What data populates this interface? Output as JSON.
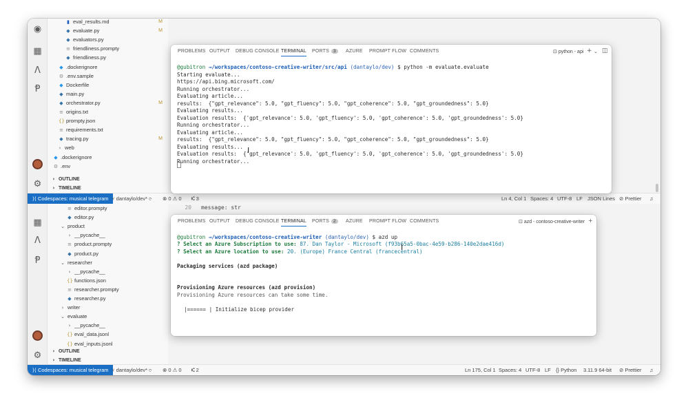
{
  "top_window": {
    "explorer_items": [
      {
        "name": "eval_results.md",
        "icon": "markdown-icon",
        "badge": "M"
      },
      {
        "name": "evaluate.py",
        "icon": "python-icon",
        "badge": "M"
      },
      {
        "name": "evaluators.py",
        "icon": "python-icon",
        "badge": ""
      },
      {
        "name": "friendliness.prompty",
        "icon": "file-icon",
        "badge": ""
      },
      {
        "name": "friendliness.py",
        "icon": "python-icon",
        "badge": ""
      },
      {
        "name": ".dockerignore",
        "icon": "docker-icon",
        "badge": ""
      },
      {
        "name": ".env.sample",
        "icon": "gear-icon",
        "badge": ""
      },
      {
        "name": "Dockerfile",
        "icon": "docker-icon",
        "badge": ""
      },
      {
        "name": "main.py",
        "icon": "python-icon",
        "badge": ""
      },
      {
        "name": "orchestrator.py",
        "icon": "python-icon",
        "badge": "M"
      },
      {
        "name": "origins.txt",
        "icon": "text-icon",
        "badge": ""
      },
      {
        "name": "prompty.json",
        "icon": "json-icon",
        "badge": ""
      },
      {
        "name": "requirements.txt",
        "icon": "text-icon",
        "badge": ""
      },
      {
        "name": "tracing.py",
        "icon": "python-icon",
        "badge": "M"
      },
      {
        "name": "web",
        "icon": "chevron-right-icon",
        "badge": ""
      },
      {
        "name": ".dockerignore",
        "icon": "docker-icon",
        "badge": ""
      },
      {
        "name": ".env",
        "icon": "gear-icon",
        "badge": ""
      }
    ],
    "sections": [
      "OUTLINE",
      "TIMELINE"
    ],
    "status": {
      "remote": "Codespaces: musical telegram",
      "branch": "dantaylo/dev*",
      "problems": "0 ⚠ 0",
      "ports": "3",
      "ln_col": "Ln 4, Col 1",
      "spaces": "Spaces: 4",
      "encoding": "UTF-8",
      "eol": "LF",
      "language": "JSON Lines",
      "formatter": "Prettier"
    },
    "panel": {
      "tabs": [
        "PROBLEMS",
        "OUTPUT",
        "DEBUG CONSOLE",
        "TERMINAL",
        "PORTS",
        "AZURE",
        "PROMPT FLOW",
        "COMMENTS"
      ],
      "ports_count": "3",
      "terminal_name": "python - api",
      "prompt_user": "@gubitron",
      "prompt_arrow": "→",
      "prompt_path": "/workspaces/contoso-creative-writer/src/api",
      "prompt_branch": "(dantaylo/dev)",
      "prompt_cmd": "$ python -m evaluate.evaluate",
      "lines": [
        "Starting evaluate...",
        "https://api.bing.microsoft.com/",
        "Running orchestrator...",
        "Evaluating article...",
        "results:  {\"gpt_relevance\": 5.0, \"gpt_fluency\": 5.0, \"gpt_coherence\": 5.0, \"gpt_groundedness\": 5.0}",
        "Evaluating results...",
        "Evaluation results:  {'gpt_relevance': 5.0, 'gpt_fluency': 5.0, 'gpt_coherence': 5.0, 'gpt_groundedness': 5.0}",
        "Running orchestrator...",
        "Evaluating article...",
        "results:  {\"gpt_relevance\": 5.0, \"gpt_fluency\": 5.0, \"gpt_coherence\": 5.0, \"gpt_groundedness\": 5.0}",
        "Evaluating results...",
        "Evaluation results:  {'gpt_relevance': 5.0, 'gpt_fluency': 5.0, 'gpt_coherence': 5.0, 'gpt_groundedness': 5.0}",
        "Running orchestrator..."
      ]
    }
  },
  "bottom_window": {
    "code_lines": [
      {
        "num": "20",
        "text": "message: str"
      }
    ],
    "explorer_items": [
      {
        "name": "editor.prompty",
        "icon": "file-icon",
        "indent": 2
      },
      {
        "name": "editor.py",
        "icon": "python-icon",
        "indent": 2
      },
      {
        "name": "product",
        "icon": "chevron-down-icon",
        "indent": 1
      },
      {
        "name": "__pycache__",
        "icon": "chevron-right-icon",
        "indent": 2
      },
      {
        "name": "product.prompty",
        "icon": "file-icon",
        "indent": 2
      },
      {
        "name": "product.py",
        "icon": "python-icon",
        "indent": 2
      },
      {
        "name": "researcher",
        "icon": "chevron-down-icon",
        "indent": 1
      },
      {
        "name": "__pycache__",
        "icon": "chevron-right-icon",
        "indent": 2
      },
      {
        "name": "functions.json",
        "icon": "json-icon",
        "indent": 2
      },
      {
        "name": "researcher.prompty",
        "icon": "file-icon",
        "indent": 2
      },
      {
        "name": "researcher.py",
        "icon": "python-icon",
        "indent": 2
      },
      {
        "name": "writer",
        "icon": "chevron-right-icon",
        "indent": 1
      },
      {
        "name": "evaluate",
        "icon": "chevron-down-icon",
        "indent": 1
      },
      {
        "name": "__pycache__",
        "icon": "chevron-right-icon",
        "indent": 2
      },
      {
        "name": "eval_data.jsonl",
        "icon": "json-icon",
        "indent": 2
      },
      {
        "name": "eval_inputs.jsonl",
        "icon": "json-icon",
        "indent": 2
      }
    ],
    "sections": [
      "OUTLINE",
      "TIMELINE"
    ],
    "status": {
      "remote": "Codespaces: musical telegram",
      "branch": "dantaylo/dev*",
      "problems": "0 ⚠ 0",
      "ports": "2",
      "ln_col": "Ln 175, Col 1",
      "spaces": "Spaces: 4",
      "encoding": "UTF-8",
      "eol": "LF",
      "language": "Python",
      "interpreter": "3.11.9 64-bit",
      "formatter": "Prettier"
    },
    "panel": {
      "tabs": [
        "PROBLEMS",
        "OUTPUT",
        "DEBUG CONSOLE",
        "TERMINAL",
        "PORTS",
        "AZURE",
        "PROMPT FLOW",
        "COMMENTS"
      ],
      "ports_count": "2",
      "terminal_name": "azd - contoso-creative-writer",
      "prompt_user": "@gubitron",
      "prompt_arrow": "→",
      "prompt_path": "/workspaces/contoso-creative-writer",
      "prompt_branch": "(dantaylo/dev)",
      "prompt_cmd": "$ azd up",
      "q1_label": "? Select an Azure Subscription to use:",
      "q1_value": "87. Dan Taylor - Microsoft (f93b65a5-0bac-4e59-b286-140e2dae416d)",
      "q2_label": "? Select an Azure location to use:",
      "q2_value": "20. (Europe) France Central (francecentral)",
      "packaging": "Packaging services (azd package)",
      "provisioning": "Provisioning Azure resources (azd provision)",
      "provisioning_note": "Provisioning Azure resources can take some time.",
      "progress": "|====== | Initialize bicep provider"
    }
  }
}
